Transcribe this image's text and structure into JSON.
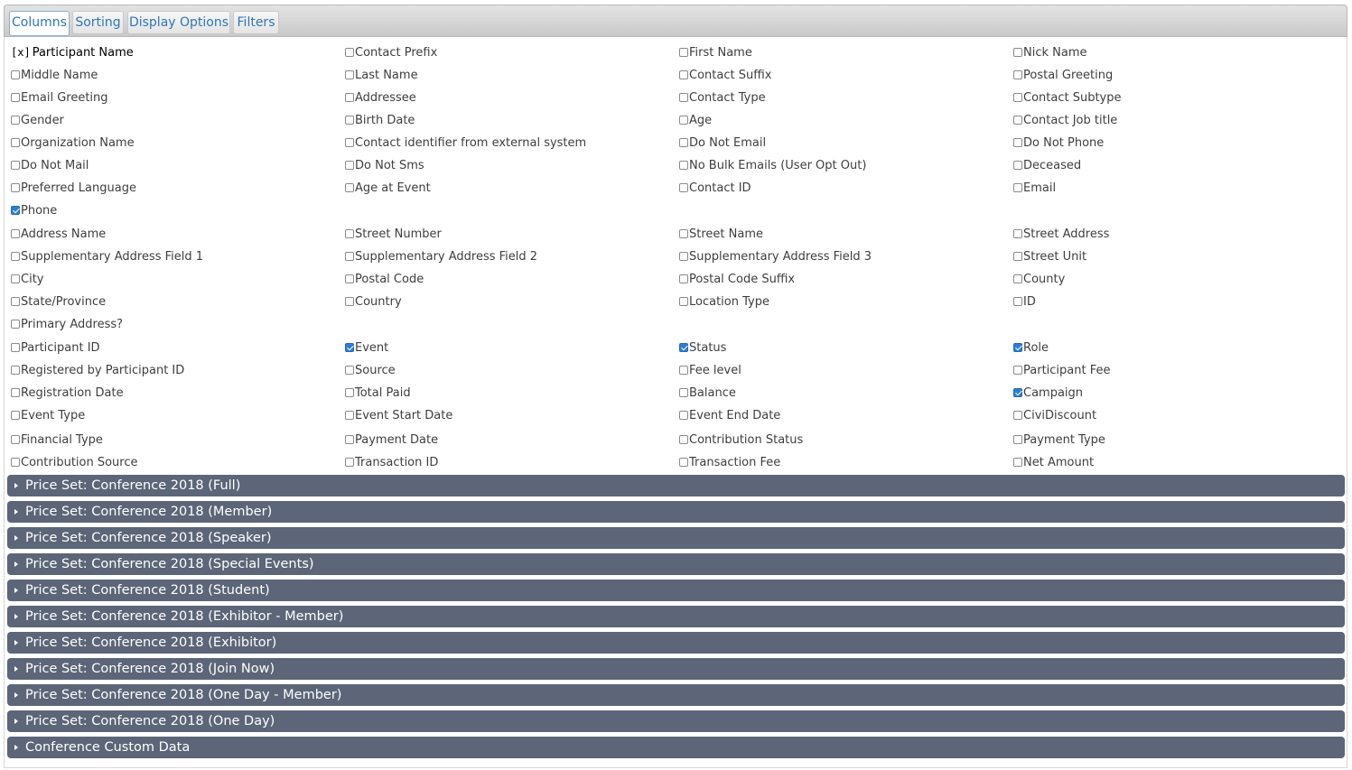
{
  "tabs": [
    {
      "label": "Columns",
      "active": true
    },
    {
      "label": "Sorting",
      "active": false
    },
    {
      "label": "Display Options",
      "active": false
    },
    {
      "label": "Filters",
      "active": false
    }
  ],
  "field_groups": [
    {
      "rows": [
        [
          {
            "label": "Participant Name",
            "checked": true,
            "marker": "[x]"
          },
          {
            "label": "Contact Prefix",
            "checked": false
          },
          {
            "label": "First Name",
            "checked": false
          },
          {
            "label": "Nick Name",
            "checked": false
          }
        ],
        [
          {
            "label": "Middle Name",
            "checked": false
          },
          {
            "label": "Last Name",
            "checked": false
          },
          {
            "label": "Contact Suffix",
            "checked": false
          },
          {
            "label": "Postal Greeting",
            "checked": false
          }
        ],
        [
          {
            "label": "Email Greeting",
            "checked": false
          },
          {
            "label": "Addressee",
            "checked": false
          },
          {
            "label": "Contact Type",
            "checked": false
          },
          {
            "label": "Contact Subtype",
            "checked": false
          }
        ],
        [
          {
            "label": "Gender",
            "checked": false
          },
          {
            "label": "Birth Date",
            "checked": false
          },
          {
            "label": "Age",
            "checked": false
          },
          {
            "label": "Contact Job title",
            "checked": false
          }
        ],
        [
          {
            "label": "Organization Name",
            "checked": false
          },
          {
            "label": "Contact identifier from external system",
            "checked": false
          },
          {
            "label": "Do Not Email",
            "checked": false
          },
          {
            "label": "Do Not Phone",
            "checked": false
          }
        ],
        [
          {
            "label": "Do Not Mail",
            "checked": false
          },
          {
            "label": "Do Not Sms",
            "checked": false
          },
          {
            "label": "No Bulk Emails (User Opt Out)",
            "checked": false
          },
          {
            "label": "Deceased",
            "checked": false
          }
        ],
        [
          {
            "label": "Preferred Language",
            "checked": false
          },
          {
            "label": "Age at Event",
            "checked": false
          },
          {
            "label": "Contact ID",
            "checked": false
          },
          {
            "label": "Email",
            "checked": false
          }
        ],
        [
          {
            "label": "Phone",
            "checked": true
          }
        ]
      ]
    },
    {
      "rows": [
        [
          {
            "label": "Address Name",
            "checked": false
          },
          {
            "label": "Street Number",
            "checked": false
          },
          {
            "label": "Street Name",
            "checked": false
          },
          {
            "label": "Street Address",
            "checked": false
          }
        ],
        [
          {
            "label": "Supplementary Address Field 1",
            "checked": false
          },
          {
            "label": "Supplementary Address Field 2",
            "checked": false
          },
          {
            "label": "Supplementary Address Field 3",
            "checked": false
          },
          {
            "label": "Street Unit",
            "checked": false
          }
        ],
        [
          {
            "label": "City",
            "checked": false
          },
          {
            "label": "Postal Code",
            "checked": false
          },
          {
            "label": "Postal Code Suffix",
            "checked": false
          },
          {
            "label": "County",
            "checked": false
          }
        ],
        [
          {
            "label": "State/Province",
            "checked": false
          },
          {
            "label": "Country",
            "checked": false
          },
          {
            "label": "Location Type",
            "checked": false
          },
          {
            "label": "ID",
            "checked": false
          }
        ],
        [
          {
            "label": "Primary Address?",
            "checked": false
          }
        ]
      ]
    },
    {
      "rows": [
        [
          {
            "label": "Participant ID",
            "checked": false
          },
          {
            "label": "Event",
            "checked": true
          },
          {
            "label": "Status",
            "checked": true
          },
          {
            "label": "Role",
            "checked": true
          }
        ],
        [
          {
            "label": "Registered by Participant ID",
            "checked": false
          },
          {
            "label": "Source",
            "checked": false
          },
          {
            "label": "Fee level",
            "checked": false
          },
          {
            "label": "Participant Fee",
            "checked": false
          }
        ],
        [
          {
            "label": "Registration Date",
            "checked": false
          },
          {
            "label": "Total Paid",
            "checked": false
          },
          {
            "label": "Balance",
            "checked": false
          },
          {
            "label": "Campaign",
            "checked": true
          }
        ],
        [
          {
            "label": "Event Type",
            "checked": false
          },
          {
            "label": "Event Start Date",
            "checked": false
          },
          {
            "label": "Event End Date",
            "checked": false
          },
          {
            "label": "CiviDiscount",
            "checked": false
          }
        ]
      ]
    },
    {
      "rows": [
        [
          {
            "label": "Financial Type",
            "checked": false
          },
          {
            "label": "Payment Date",
            "checked": false
          },
          {
            "label": "Contribution Status",
            "checked": false
          },
          {
            "label": "Payment Type",
            "checked": false
          }
        ],
        [
          {
            "label": "Contribution Source",
            "checked": false
          },
          {
            "label": "Transaction ID",
            "checked": false
          },
          {
            "label": "Transaction Fee",
            "checked": false
          },
          {
            "label": "Net Amount",
            "checked": false
          }
        ]
      ]
    }
  ],
  "accordions": [
    "Price Set: Conference 2018 (Full)",
    "Price Set: Conference 2018 (Member)",
    "Price Set: Conference 2018 (Speaker)",
    "Price Set: Conference 2018 (Special Events)",
    "Price Set: Conference 2018 (Student)",
    "Price Set: Conference 2018 (Exhibitor - Member)",
    "Price Set: Conference 2018 (Exhibitor)",
    "Price Set: Conference 2018 (Join Now)",
    "Price Set: Conference 2018 (One Day - Member)",
    "Price Set: Conference 2018 (One Day)",
    "Conference Custom Data"
  ],
  "colors": {
    "accordion_bg": "#5c6678",
    "checkbox_checked": "#2c7fd6",
    "tab_text": "#2e76b8"
  }
}
